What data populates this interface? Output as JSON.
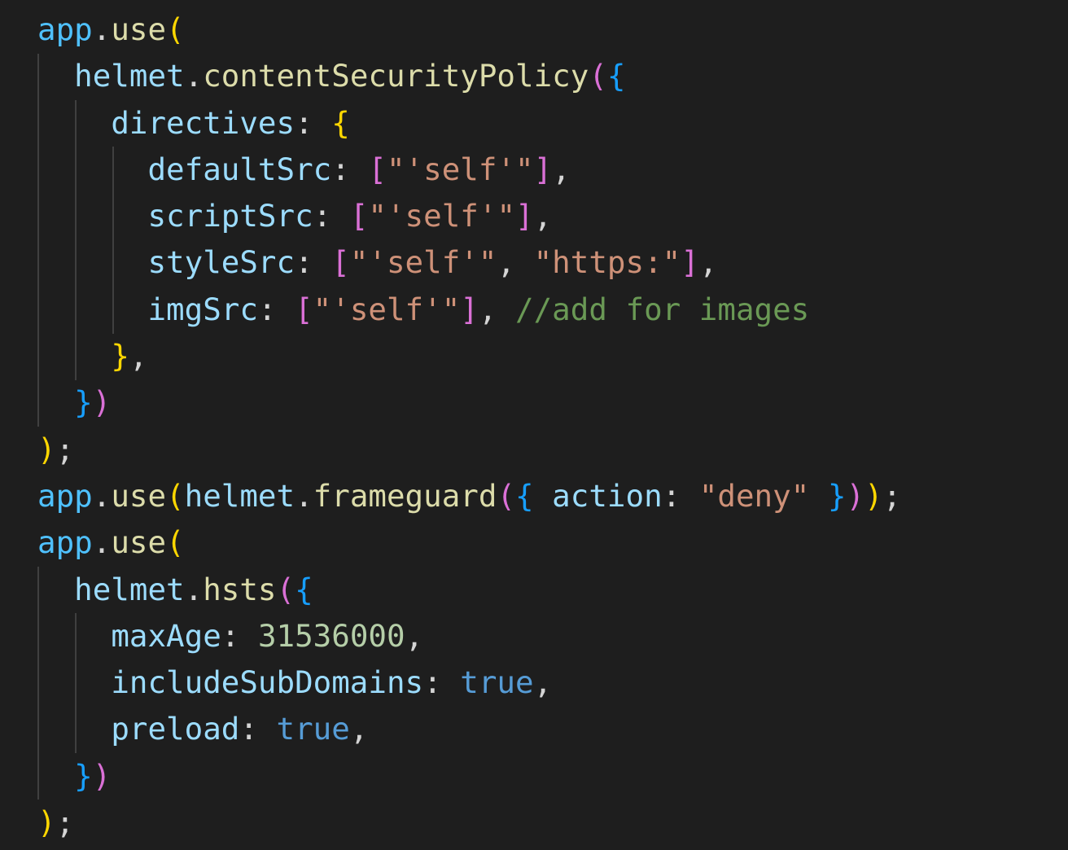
{
  "colors": {
    "background": "#1e1e1e",
    "default": "#d4d4d4",
    "variable": "#4fc1ff",
    "property": "#9cdcfe",
    "function": "#dcdcaa",
    "string": "#ce9178",
    "number": "#b5cea8",
    "keyword": "#569cd6",
    "comment": "#6a9955",
    "bracket_gold": "#ffd700",
    "bracket_pink": "#da70d6",
    "bracket_blue": "#179fff",
    "indent_guide": "#404040"
  },
  "code_lines": [
    [
      [
        "app",
        "variable"
      ],
      [
        ".",
        "default"
      ],
      [
        "use",
        "function"
      ],
      [
        "(",
        "bracket_gold"
      ]
    ],
    [
      [
        "  ",
        "default"
      ],
      [
        "helmet",
        "property"
      ],
      [
        ".",
        "default"
      ],
      [
        "contentSecurityPolicy",
        "function"
      ],
      [
        "(",
        "bracket_pink"
      ],
      [
        "{",
        "bracket_blue"
      ]
    ],
    [
      [
        "    ",
        "default"
      ],
      [
        "directives",
        "property"
      ],
      [
        ": ",
        "default"
      ],
      [
        "{",
        "bracket_gold"
      ]
    ],
    [
      [
        "      ",
        "default"
      ],
      [
        "defaultSrc",
        "property"
      ],
      [
        ": ",
        "default"
      ],
      [
        "[",
        "bracket_pink"
      ],
      [
        "\"'self'\"",
        "string"
      ],
      [
        "]",
        "bracket_pink"
      ],
      [
        ",",
        "default"
      ]
    ],
    [
      [
        "      ",
        "default"
      ],
      [
        "scriptSrc",
        "property"
      ],
      [
        ": ",
        "default"
      ],
      [
        "[",
        "bracket_pink"
      ],
      [
        "\"'self'\"",
        "string"
      ],
      [
        "]",
        "bracket_pink"
      ],
      [
        ",",
        "default"
      ]
    ],
    [
      [
        "      ",
        "default"
      ],
      [
        "styleSrc",
        "property"
      ],
      [
        ": ",
        "default"
      ],
      [
        "[",
        "bracket_pink"
      ],
      [
        "\"'self'\"",
        "string"
      ],
      [
        ", ",
        "default"
      ],
      [
        "\"https:\"",
        "string"
      ],
      [
        "]",
        "bracket_pink"
      ],
      [
        ",",
        "default"
      ]
    ],
    [
      [
        "      ",
        "default"
      ],
      [
        "imgSrc",
        "property"
      ],
      [
        ": ",
        "default"
      ],
      [
        "[",
        "bracket_pink"
      ],
      [
        "\"'self'\"",
        "string"
      ],
      [
        "]",
        "bracket_pink"
      ],
      [
        ", ",
        "default"
      ],
      [
        "//add for images",
        "comment"
      ]
    ],
    [
      [
        "    ",
        "default"
      ],
      [
        "}",
        "bracket_gold"
      ],
      [
        ",",
        "default"
      ]
    ],
    [
      [
        "  ",
        "default"
      ],
      [
        "}",
        "bracket_blue"
      ],
      [
        ")",
        "bracket_pink"
      ]
    ],
    [
      [
        ")",
        "bracket_gold"
      ],
      [
        ";",
        "default"
      ]
    ],
    [
      [
        "app",
        "variable"
      ],
      [
        ".",
        "default"
      ],
      [
        "use",
        "function"
      ],
      [
        "(",
        "bracket_gold"
      ],
      [
        "helmet",
        "property"
      ],
      [
        ".",
        "default"
      ],
      [
        "frameguard",
        "function"
      ],
      [
        "(",
        "bracket_pink"
      ],
      [
        "{",
        "bracket_blue"
      ],
      [
        " action",
        "property"
      ],
      [
        ": ",
        "default"
      ],
      [
        "\"deny\"",
        "string"
      ],
      [
        " ",
        "default"
      ],
      [
        "}",
        "bracket_blue"
      ],
      [
        ")",
        "bracket_pink"
      ],
      [
        ")",
        "bracket_gold"
      ],
      [
        ";",
        "default"
      ]
    ],
    [
      [
        "app",
        "variable"
      ],
      [
        ".",
        "default"
      ],
      [
        "use",
        "function"
      ],
      [
        "(",
        "bracket_gold"
      ]
    ],
    [
      [
        "  ",
        "default"
      ],
      [
        "helmet",
        "property"
      ],
      [
        ".",
        "default"
      ],
      [
        "hsts",
        "function"
      ],
      [
        "(",
        "bracket_pink"
      ],
      [
        "{",
        "bracket_blue"
      ]
    ],
    [
      [
        "    ",
        "default"
      ],
      [
        "maxAge",
        "property"
      ],
      [
        ": ",
        "default"
      ],
      [
        "31536000",
        "number"
      ],
      [
        ",",
        "default"
      ]
    ],
    [
      [
        "    ",
        "default"
      ],
      [
        "includeSubDomains",
        "property"
      ],
      [
        ": ",
        "default"
      ],
      [
        "true",
        "keyword"
      ],
      [
        ",",
        "default"
      ]
    ],
    [
      [
        "    ",
        "default"
      ],
      [
        "preload",
        "property"
      ],
      [
        ": ",
        "default"
      ],
      [
        "true",
        "keyword"
      ],
      [
        ",",
        "default"
      ]
    ],
    [
      [
        "  ",
        "default"
      ],
      [
        "}",
        "bracket_blue"
      ],
      [
        ")",
        "bracket_pink"
      ]
    ],
    [
      [
        ")",
        "bracket_gold"
      ],
      [
        ";",
        "default"
      ]
    ]
  ]
}
